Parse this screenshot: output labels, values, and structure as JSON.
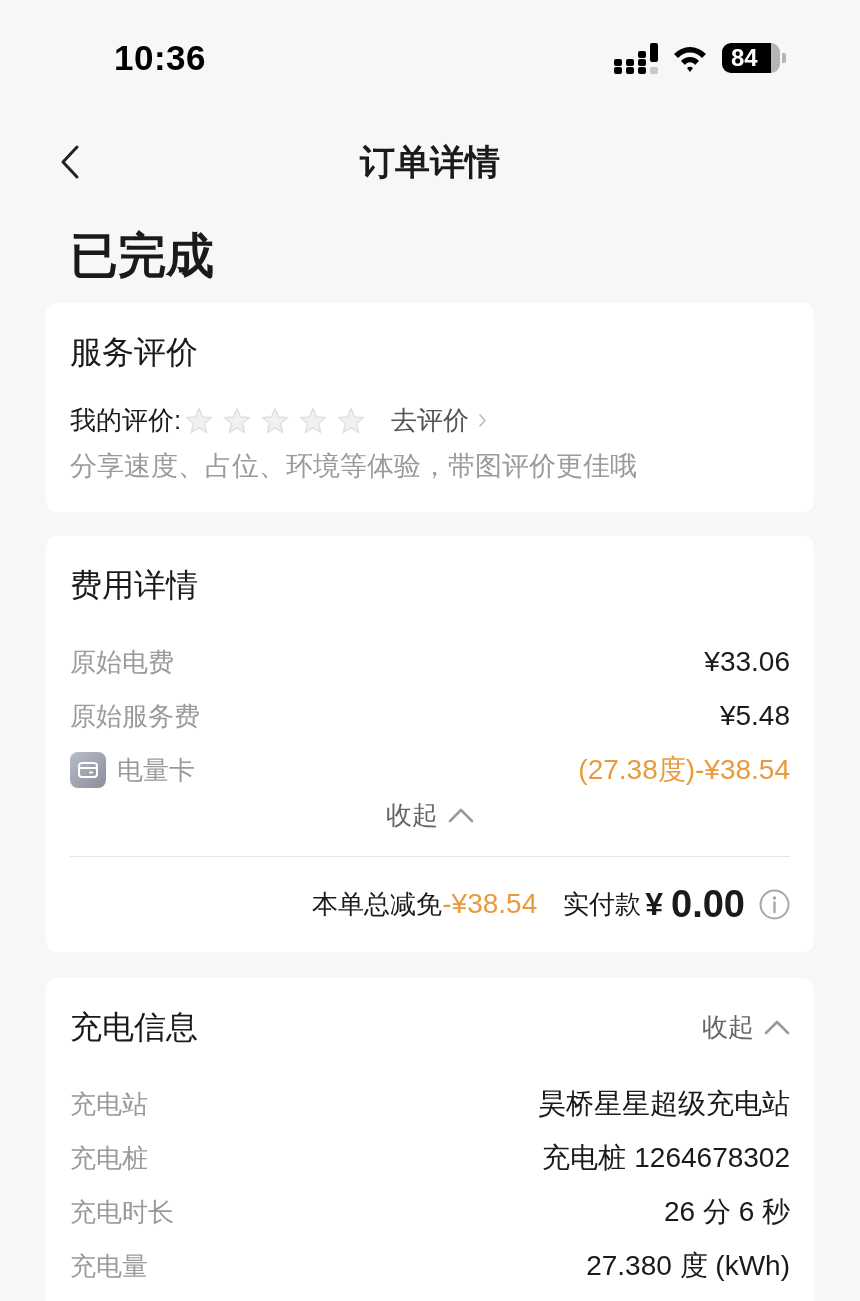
{
  "status_bar": {
    "time": "10:36",
    "battery": "84"
  },
  "nav": {
    "title": "订单详情"
  },
  "order_status": "已完成",
  "rating_card": {
    "title": "服务评价",
    "label": "我的评价:",
    "stars": 0,
    "action": "去评价",
    "hint": "分享速度、占位、环境等体验，带图评价更佳哦"
  },
  "fee_card": {
    "title": "费用详情",
    "rows": [
      {
        "kind": "plain",
        "label": "原始电费",
        "value": "¥33.06"
      },
      {
        "kind": "plain",
        "label": "原始服务费",
        "value": "¥5.48"
      },
      {
        "kind": "discount",
        "label": "电量卡",
        "value": "(27.38度)-¥38.54"
      }
    ],
    "toggle": {
      "label": "收起",
      "expanded": true
    },
    "summary": {
      "discount_label": "本单总减免",
      "discount_value": "-¥38.54",
      "paid_label": "实付款",
      "currency": "¥",
      "paid_amount": "0.00"
    }
  },
  "charge_card": {
    "title": "充电信息",
    "toggle": {
      "label": "收起",
      "expanded": true
    },
    "rows": [
      {
        "label": "充电站",
        "value": "昊桥星星超级充电站"
      },
      {
        "label": "充电桩",
        "value": "充电桩 1264678302"
      },
      {
        "label": "充电时长",
        "value": "26 分 6 秒"
      },
      {
        "label": "充电量",
        "value": "27.380 度 (kWh)"
      }
    ]
  }
}
